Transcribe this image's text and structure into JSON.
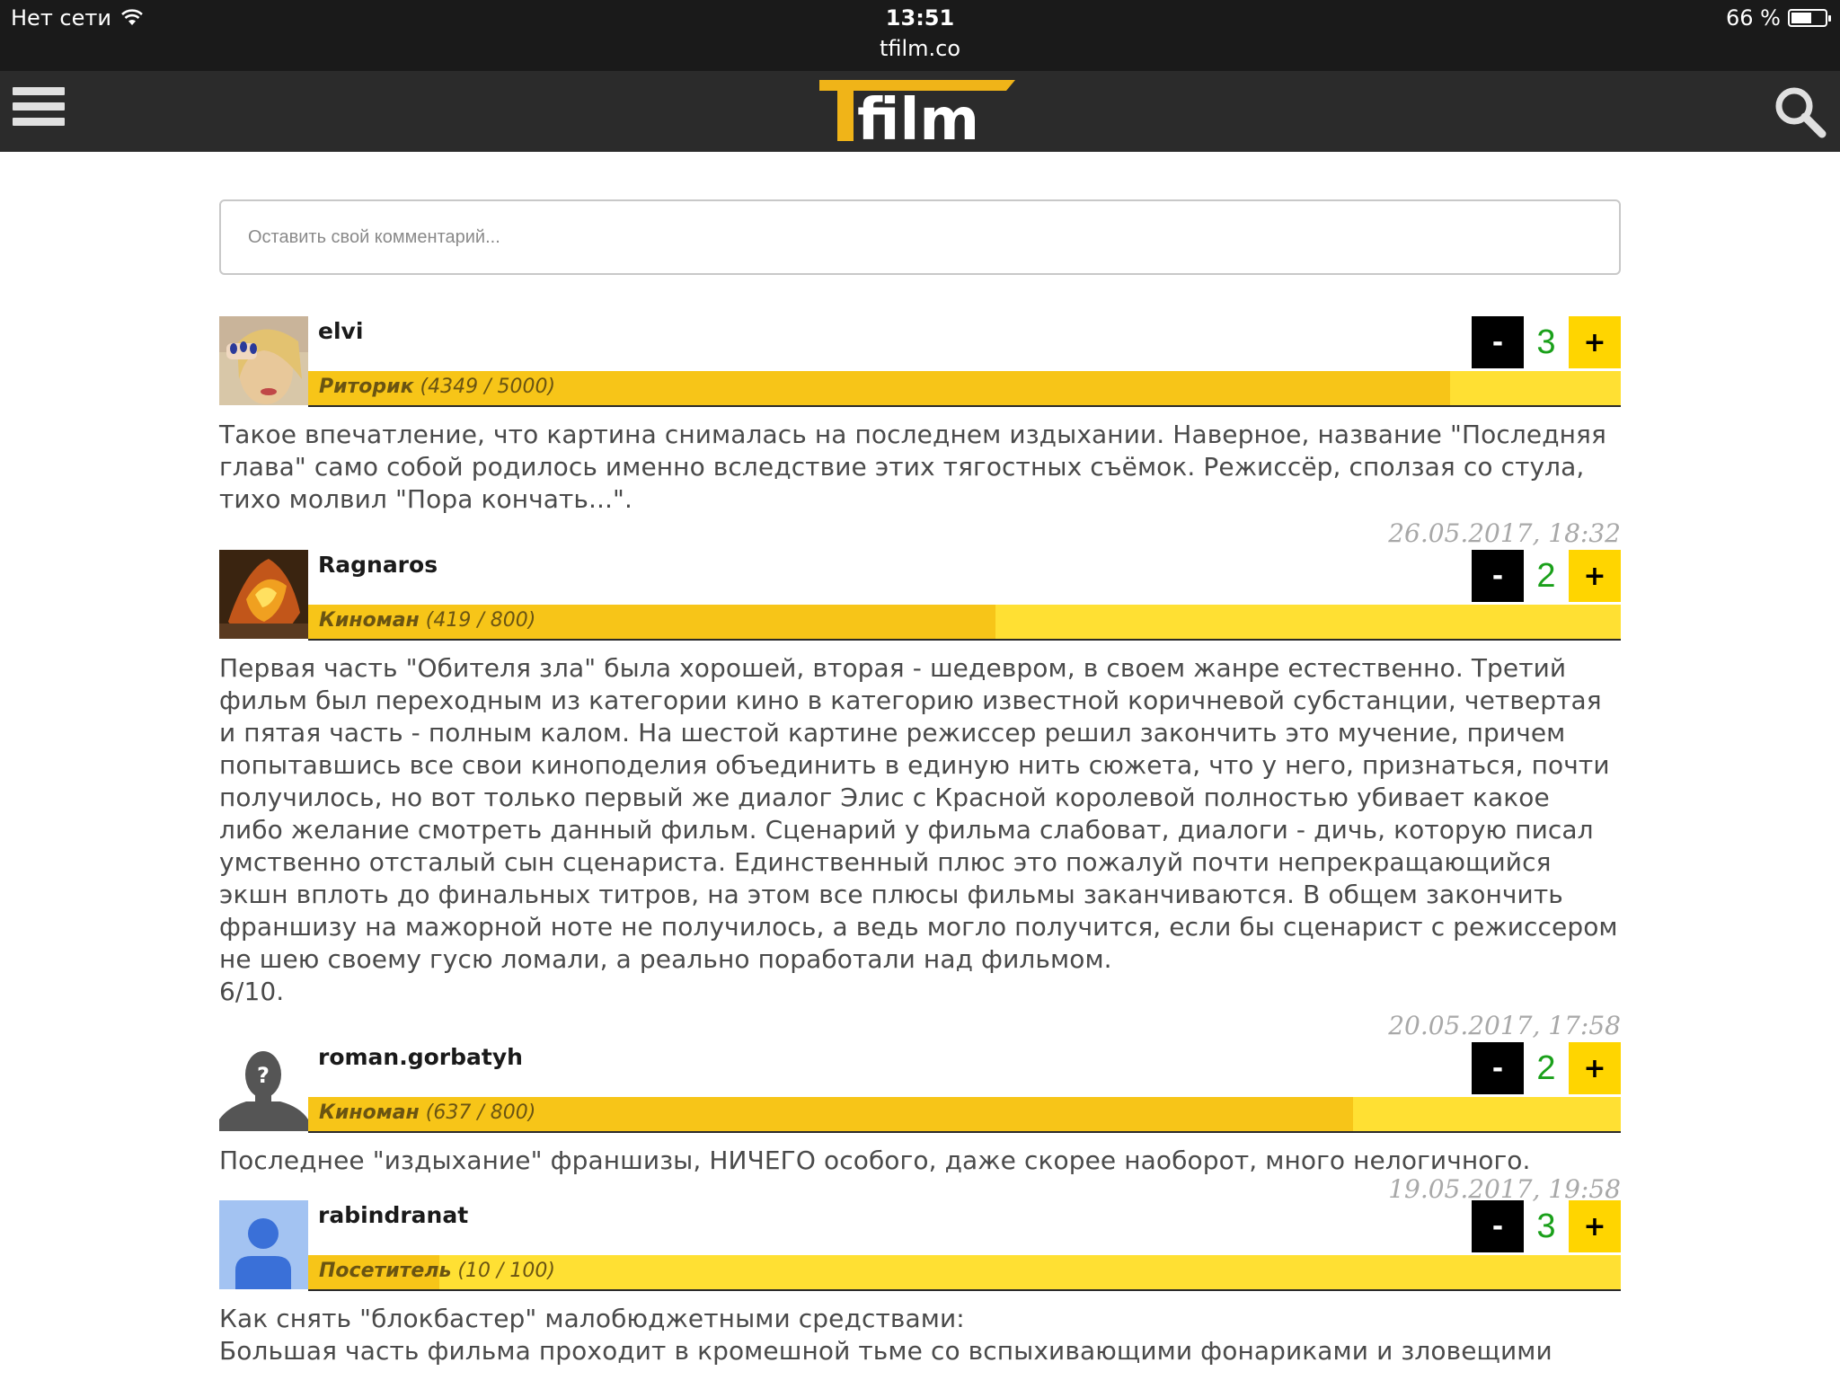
{
  "status_bar": {
    "network": "Нет сети",
    "time": "13:51",
    "battery": "66 %",
    "battery_level": 0.66,
    "url": "tfilm.co"
  },
  "header": {
    "logo_text": "Tfilm"
  },
  "comment_form": {
    "placeholder": "Оставить свой комментарий..."
  },
  "comments": [
    {
      "user": "elvi",
      "rank_name": "Риторик",
      "rank_points": "(4349 / 5000)",
      "rank_progress": 0.8698,
      "votes": "3",
      "text": "Такое впечатление, что картина снималась на последнем издыхании. Наверное, название \"Последняя глава\" само собой родилось именно вследствие этих тягостных съёмок. Режиссёр, сползая со стула, тихо молвил \"Пора кончать...\".",
      "date": "26.05.2017, 18:32"
    },
    {
      "user": "Ragnaros",
      "rank_name": "Киноман",
      "rank_points": "(419 / 800)",
      "rank_progress": 0.52375,
      "votes": "2",
      "text": "Первая часть \"Обителя зла\" была хорошей, вторая - шедевром, в своем жанре естественно. Третий фильм был переходным из категории кино в категорию известной коричневой субстанции, четвертая и пятая часть - полным калом. На шестой картине режиссер решил закончить это мучение, причем попытавшись все свои киноподелия объединить в единую нить сюжета, что у него, признаться, почти получилось, но вот только первый же диалог Элис с Красной королевой полностью убивает какое либо желание смотреть данный фильм. Сценарий у фильма слабоват, диалоги - дичь, которую писал умственно отсталый сын сценариста. Единственный плюс это пожалуй почти непрекращающийся экшн вплоть до финальных титров, на этом все плюсы фильмы заканчиваются. В общем закончить франшизу на мажорной ноте не получилось, а ведь могло получится, если бы сценарист с режиссером не шею своему гусю ломали, а реально поработали над фильмом.\n6/10.",
      "date": "20.05.2017, 17:58"
    },
    {
      "user": "roman.gorbatyh",
      "rank_name": "Киноман",
      "rank_points": "(637 / 800)",
      "rank_progress": 0.79625,
      "votes": "2",
      "text": "Последнее \"издыхание\" франшизы, НИЧЕГО особого, даже скорее наоборот, много нелогичного.",
      "date": "19.05.2017, 19:58"
    },
    {
      "user": "rabindranat",
      "rank_name": "Посетитель",
      "rank_points": "(10 / 100)",
      "rank_progress": 0.1,
      "votes": "3",
      "text": "Как снять \"блокбастер\" малобюджетными средствами:\nБольшая часть фильма проходит в кромешной тьме со вспыхивающими фонариками и зловещими",
      "date": ""
    }
  ],
  "vote_labels": {
    "minus": "-",
    "plus": "+"
  },
  "colors": {
    "header_bg": "#2b2b2b",
    "accent_yellow": "#ffd500",
    "rank_bar": "#ffe033",
    "rank_fill": "#f7c518",
    "vote_count": "#1aa01a"
  }
}
